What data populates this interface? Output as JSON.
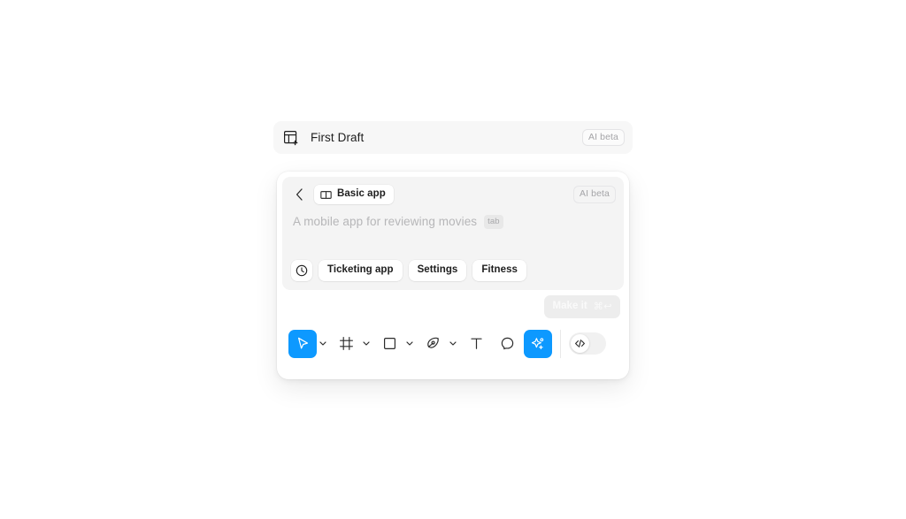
{
  "first_draft_bar": {
    "icon": "frame-add-icon",
    "title": "First Draft",
    "badge": "AI beta"
  },
  "prompt_panel": {
    "back_icon": "chevron-left-icon",
    "mode_chip": {
      "icon": "book-icon",
      "label": "Basic app"
    },
    "badge": "AI beta",
    "placeholder": "A mobile app for reviewing movies",
    "tab_hint": "tab",
    "history_icon": "clock-history-icon",
    "suggestions": [
      {
        "label": "Ticketing app"
      },
      {
        "label": "Settings"
      },
      {
        "label": "Fitness"
      }
    ],
    "submit": {
      "label": "Make it",
      "shortcut": "⌘↩",
      "disabled": true
    }
  },
  "toolbar": {
    "tools": [
      {
        "name": "move-tool",
        "icon": "cursor-icon",
        "active": true,
        "has_caret": true
      },
      {
        "name": "frame-tool",
        "icon": "frame-icon",
        "active": false,
        "has_caret": true
      },
      {
        "name": "shape-tool",
        "icon": "square-icon",
        "active": false,
        "has_caret": true
      },
      {
        "name": "pen-tool",
        "icon": "pen-icon",
        "active": false,
        "has_caret": true
      },
      {
        "name": "text-tool",
        "icon": "text-icon",
        "active": false,
        "has_caret": false
      },
      {
        "name": "comment-tool",
        "icon": "comment-icon",
        "active": false,
        "has_caret": false
      },
      {
        "name": "ai-tool",
        "icon": "sparkle-add-icon",
        "active": true,
        "has_caret": false
      }
    ],
    "dev_mode": {
      "icon": "code-icon",
      "enabled": false
    },
    "accent_color": "#0d99ff"
  }
}
